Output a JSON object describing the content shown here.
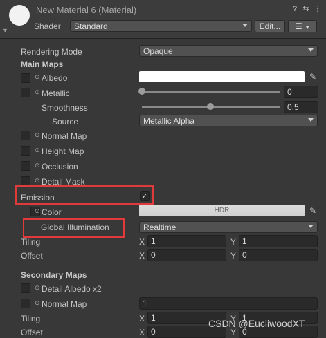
{
  "header": {
    "title": "New Material 6 (Material)",
    "shader_label": "Shader",
    "shader_value": "Standard",
    "edit_button": "Edit...",
    "help_icon": "?",
    "presets_icon": "⇆",
    "menu_icon": "⋮",
    "list_icon": "☰"
  },
  "rendering_mode": {
    "label": "Rendering Mode",
    "value": "Opaque"
  },
  "main_maps": {
    "title": "Main Maps",
    "albedo": {
      "label": "Albedo",
      "color": "#ffffff"
    },
    "metallic": {
      "label": "Metallic",
      "value": "0",
      "level": 0.0
    },
    "smoothness": {
      "label": "Smoothness",
      "value": "0.5",
      "level": 0.5
    },
    "source": {
      "label": "Source",
      "value": "Metallic Alpha"
    },
    "normal_map": {
      "label": "Normal Map"
    },
    "height_map": {
      "label": "Height Map"
    },
    "occlusion": {
      "label": "Occlusion"
    },
    "detail_mask": {
      "label": "Detail Mask"
    },
    "emission": {
      "label": "Emission",
      "checked": true,
      "check_glyph": "✓"
    },
    "color": {
      "label": "Color",
      "value": "HDR"
    },
    "global_illumination": {
      "label": "Global Illumination",
      "value": "Realtime"
    },
    "tiling": {
      "label": "Tiling",
      "x_axis": "X",
      "x": "1",
      "y_axis": "Y",
      "y": "1"
    },
    "offset": {
      "label": "Offset",
      "x_axis": "X",
      "x": "0",
      "y_axis": "Y",
      "y": "0"
    }
  },
  "secondary_maps": {
    "title": "Secondary Maps",
    "detail_albedo": {
      "label": "Detail Albedo x2"
    },
    "normal_map": {
      "label": "Normal Map",
      "value": "1"
    },
    "tiling": {
      "label": "Tiling",
      "x_axis": "X",
      "x": "1",
      "y_axis": "Y",
      "y": "1"
    },
    "offset": {
      "label": "Offset",
      "x_axis": "X",
      "x": "0",
      "y_axis": "Y",
      "y": "0"
    }
  },
  "watermark": "CSDN @EucliwoodXT",
  "slot_dot": "⊙",
  "picker_glyph": "✎",
  "colors": {
    "highlight": "#e03a3a",
    "background": "#383838"
  }
}
